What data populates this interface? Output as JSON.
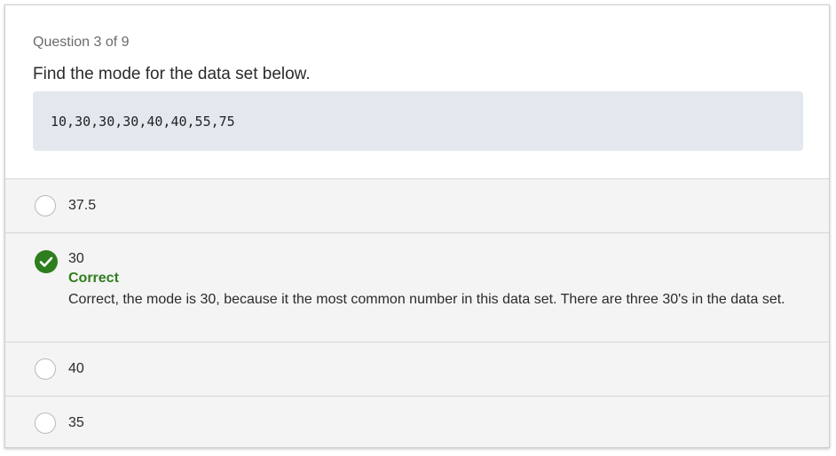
{
  "question": {
    "number_label": "Question 3 of 9",
    "prompt": "Find the mode for the data set below.",
    "dataset": "10,30,30,30,40,40,55,75"
  },
  "options": [
    {
      "label": "37.5",
      "state": "unselected"
    },
    {
      "label": "30",
      "state": "selected-correct"
    },
    {
      "label": "40",
      "state": "unselected"
    },
    {
      "label": "35",
      "state": "unselected"
    }
  ],
  "feedback": {
    "title": "Correct",
    "text": "Correct, the mode is 30, because it the most common number in this data set. There are three 30's in the data set."
  },
  "colors": {
    "correct_green": "#2e7d1e",
    "dataset_bg": "#e3e8ee",
    "option_bg": "#f4f4f4"
  },
  "icons": {
    "correct_option": "checkmark-circle-icon",
    "unselected_option": "radio-circle-icon"
  }
}
